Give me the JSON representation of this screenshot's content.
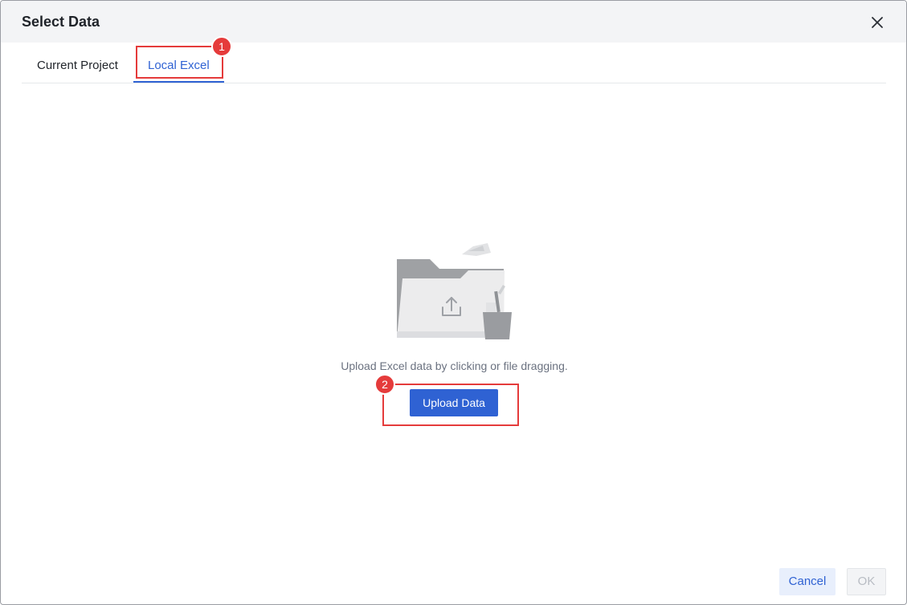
{
  "dialog": {
    "title": "Select Data",
    "close_icon": "close-icon"
  },
  "tabs": [
    {
      "label": "Current Project",
      "active": false
    },
    {
      "label": "Local Excel",
      "active": true
    }
  ],
  "annotations": [
    {
      "number": "1"
    },
    {
      "number": "2"
    }
  ],
  "upload": {
    "illustration_icon": "folder-upload-icon",
    "hint": "Upload Excel data by clicking or file dragging.",
    "button_label": "Upload Data"
  },
  "footer": {
    "cancel_label": "Cancel",
    "ok_label": "OK",
    "ok_disabled": true
  },
  "colors": {
    "accent": "#2f62d3",
    "annotation": "#e53b3b",
    "header_bg": "#f3f4f6"
  }
}
